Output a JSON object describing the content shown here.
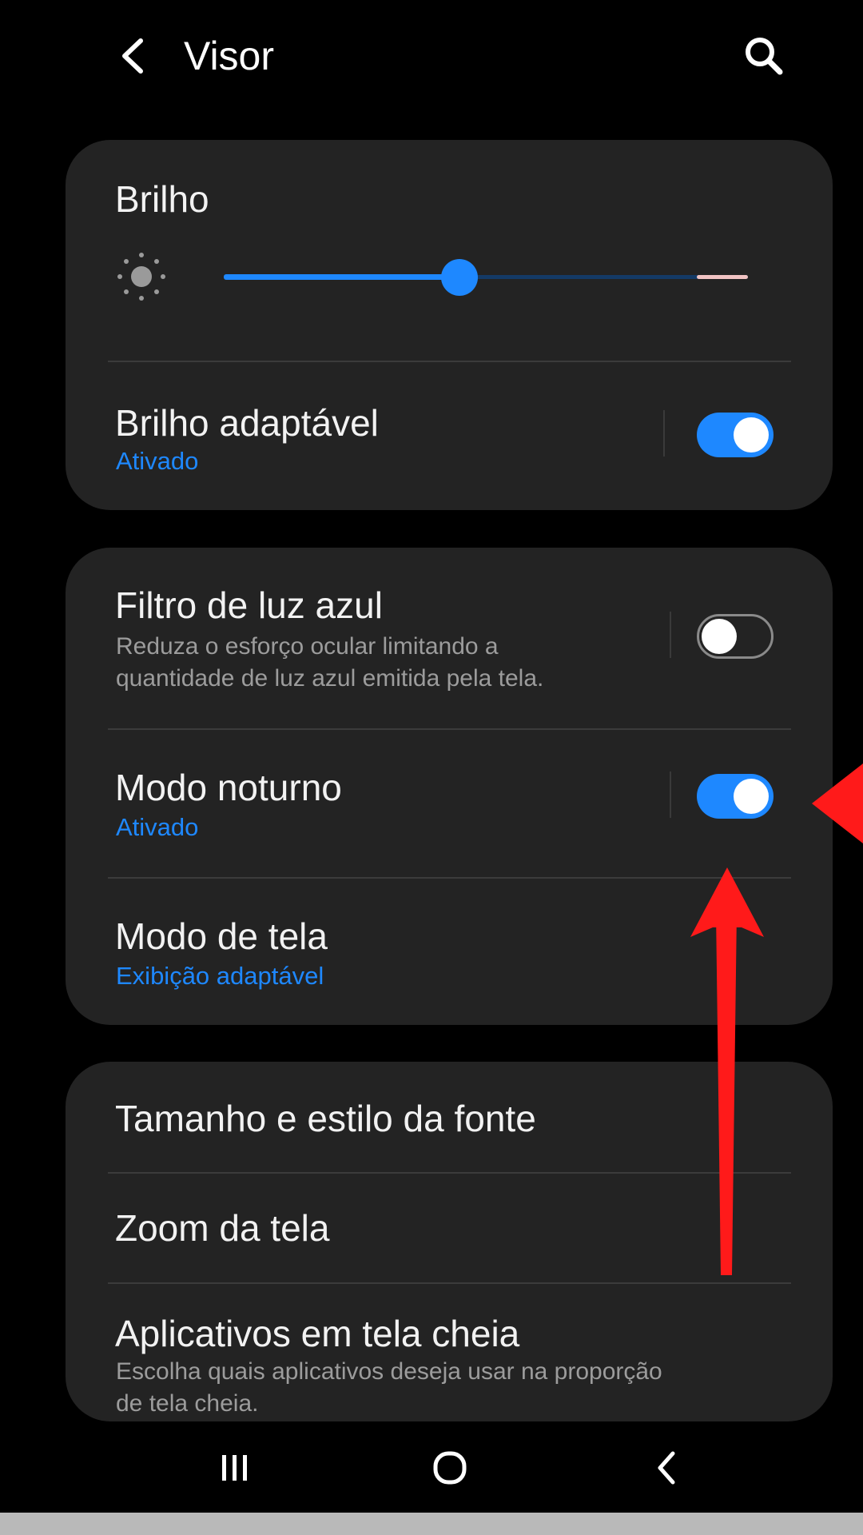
{
  "header": {
    "title": "Visor",
    "back_icon": "chevron-left-icon",
    "search_icon": "search-icon"
  },
  "brightness": {
    "label": "Brilho",
    "level": 0.45,
    "icon": "sun-icon"
  },
  "adaptive_brightness": {
    "label": "Brilho adaptável",
    "status": "Ativado",
    "enabled": true
  },
  "blue_light_filter": {
    "label": "Filtro de luz azul",
    "description_line1": "Reduza o esforço ocular limitando a",
    "description_line2": "quantidade de luz azul emitida pela tela.",
    "enabled": false
  },
  "night_mode": {
    "label": "Modo noturno",
    "status": "Ativado",
    "enabled": true
  },
  "screen_mode": {
    "label": "Modo de tela",
    "status": "Exibição adaptável"
  },
  "font": {
    "label": "Tamanho e estilo da fonte"
  },
  "screen_zoom": {
    "label": "Zoom da tela"
  },
  "fullscreen_apps": {
    "label": "Aplicativos em tela cheia",
    "description_line1": "Escolha quais aplicativos deseja usar na proporção",
    "description_line2": "de tela cheia."
  },
  "navbar": {
    "recents_icon": "recents-icon",
    "home_icon": "home-icon",
    "back_icon": "back-icon"
  },
  "colors": {
    "accent": "#1e88ff",
    "card": "#232323",
    "annotation_arrow": "#ff1a1a"
  }
}
